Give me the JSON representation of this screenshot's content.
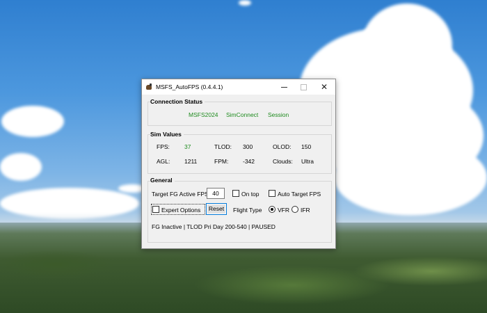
{
  "window": {
    "title": "MSFS_AutoFPS (0.4.4.1)",
    "close_symbol": "✕"
  },
  "connection_status": {
    "title": "Connection Status",
    "items": [
      "MSFS2024",
      "SimConnect",
      "Session"
    ]
  },
  "sim_values": {
    "title": "Sim Values",
    "fps_label": "FPS:",
    "fps_value": "37",
    "tlod_label": "TLOD:",
    "tlod_value": "300",
    "olod_label": "OLOD:",
    "olod_value": "150",
    "agl_label": "AGL:",
    "agl_value": "1211",
    "fpm_label": "FPM:",
    "fpm_value": "-342",
    "clouds_label": "Clouds:",
    "clouds_value": "Ultra"
  },
  "general": {
    "title": "General",
    "target_fps_label": "Target FG Active FPS",
    "target_fps_value": "40",
    "on_top_label": "On top",
    "auto_target_label": "Auto Target FPS",
    "expert_label": "Expert Options",
    "reset_label": "Reset",
    "flight_type_label": "Flight Type",
    "vfr_label": "VFR",
    "ifr_label": "IFR",
    "status_line": "FG Inactive | TLOD Pri Day 200-540 | PAUSED"
  },
  "colors": {
    "status_green": "#1d8a1d",
    "button_border": "#0078d7"
  }
}
